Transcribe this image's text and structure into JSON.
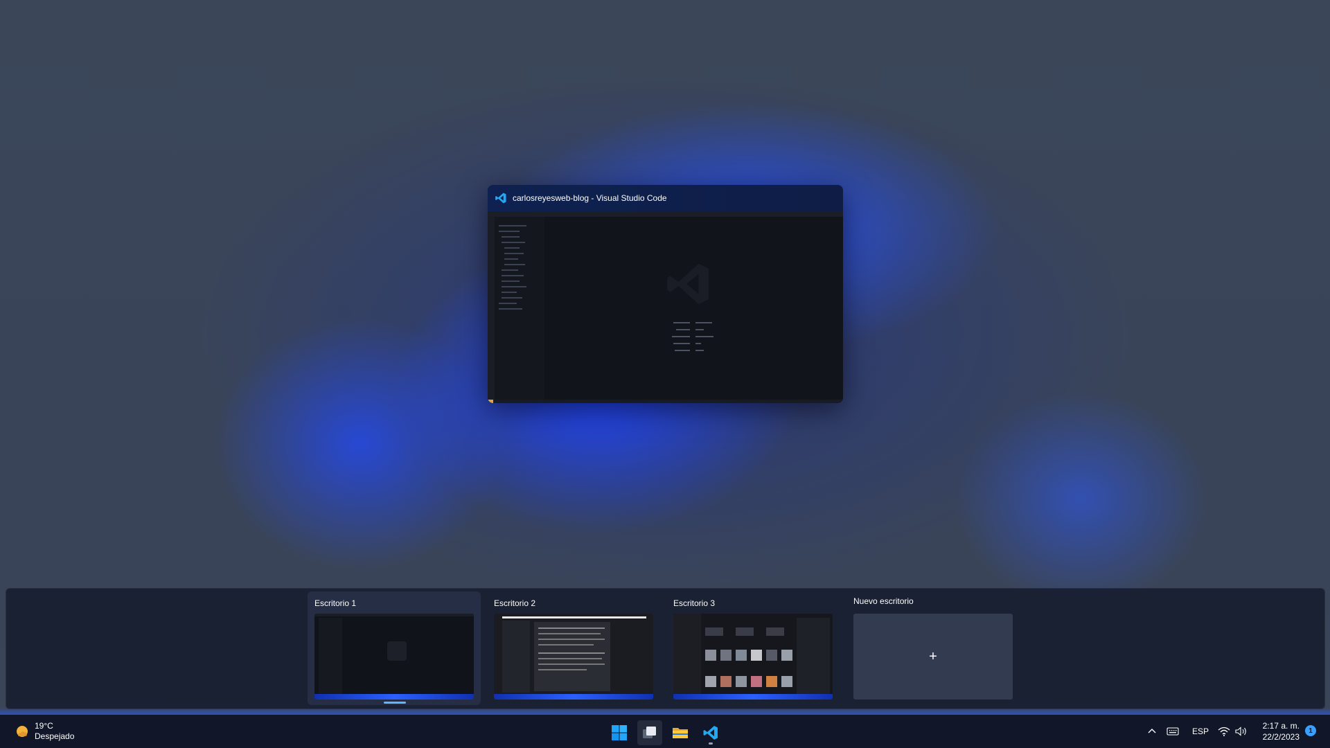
{
  "window": {
    "title": "carlosreyesweb-blog - Visual Studio Code",
    "app_icon": "vscode-icon"
  },
  "desktops": [
    {
      "label": "Escritorio 1",
      "active": true
    },
    {
      "label": "Escritorio 2",
      "active": false
    },
    {
      "label": "Escritorio 3",
      "active": false
    }
  ],
  "new_desktop": {
    "label": "Nuevo escritorio",
    "plus": "+"
  },
  "weather": {
    "temp": "19°C",
    "condition": "Despejado",
    "icon": "sun-cloud-icon"
  },
  "taskbar": {
    "apps": [
      "windows-start-icon",
      "task-view-icon",
      "file-explorer-icon",
      "vscode-icon"
    ]
  },
  "tray": {
    "language": "ESP",
    "icons": [
      "chevron-up-icon",
      "keyboard-icon",
      "wifi-icon",
      "volume-icon"
    ]
  },
  "clock": {
    "time": "2:17 a. m.",
    "date": "22/2/2023"
  },
  "notifications": {
    "count": "1"
  },
  "colors": {
    "accent": "#3aa0ff",
    "vscode_blue": "#23a8f2",
    "taskbar": "#10162a"
  }
}
